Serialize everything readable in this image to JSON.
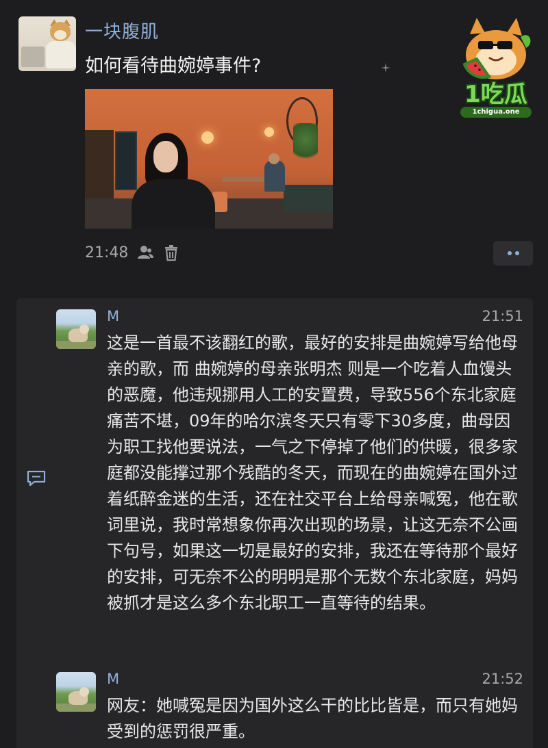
{
  "post": {
    "author": "一块腹肌",
    "title": "如何看待曲婉婷事件?",
    "time": "21:48"
  },
  "logo": {
    "text": "1吃瓜",
    "url": "1chigua.one"
  },
  "comments": [
    {
      "name": "M",
      "time": "21:51",
      "text": "这是一首最不该翻红的歌，最好的安排是曲婉婷写给他母亲的歌，而 曲婉婷的母亲张明杰 则是一个吃着人血馒头的恶魔，他违规挪用人工的安置费，导致556个东北家庭痛苦不堪，09年的哈尔滨冬天只有零下30多度，曲母因为职工找他要说法，一气之下停掉了他们的供暖，很多家庭都没能撑过那个残酷的冬天，而现在的曲婉婷在国外过着纸醉金迷的生活，还在社交平台上给母亲喊冤，他在歌词里说，我时常想象你再次出现的场景，让这无奈不公画下句号，如果这一切是最好的安排，我还在等待那个最好的安排，可无奈不公的明明是那个无数个东北家庭，妈妈被抓才是这么多个东北职工一直等待的结果。"
    },
    {
      "name": "M",
      "time": "21:52",
      "text": "网友：她喊冤是因为国外这么干的比比皆是，而只有她妈受到的惩罚很严重。"
    }
  ],
  "icons": {
    "post_meta": [
      "user-icon",
      "trash-icon"
    ],
    "more": "more-icon",
    "comment": "comment-icon"
  },
  "colors": {
    "background": "#1d1d1f",
    "panel": "#262629",
    "name_link": "#8fb0d8",
    "text": "#e8e8e8",
    "muted": "#a8a8a8"
  }
}
